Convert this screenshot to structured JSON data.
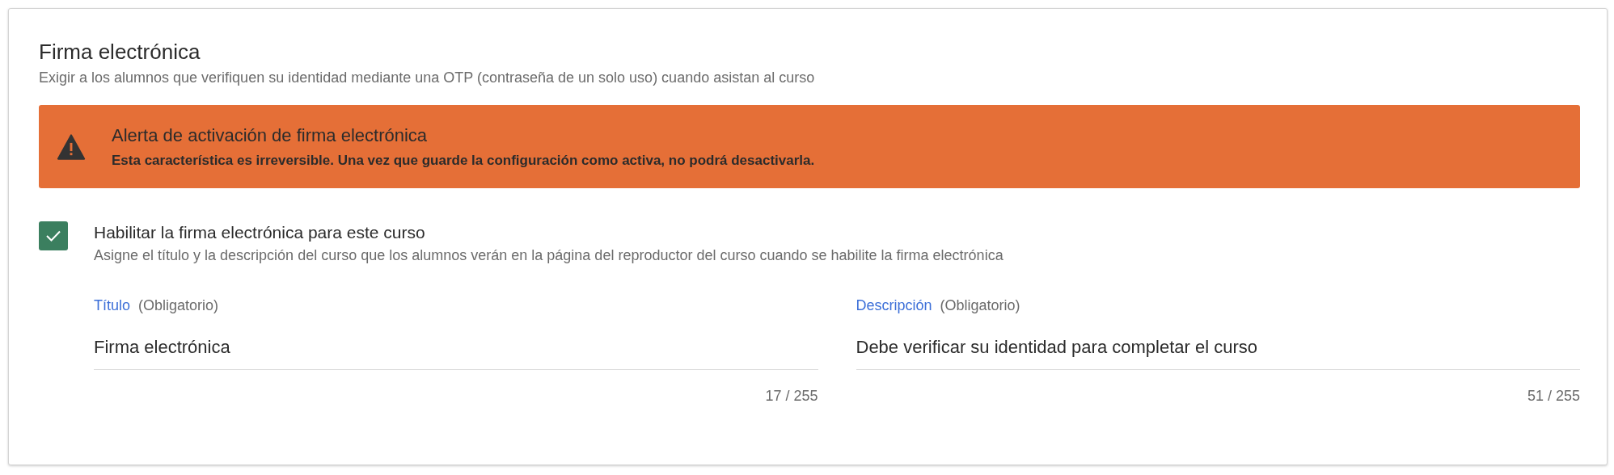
{
  "section": {
    "title": "Firma electrónica",
    "description": "Exigir a los alumnos que verifiquen su identidad mediante una OTP (contraseña de un solo uso) cuando asistan al curso"
  },
  "alert": {
    "title": "Alerta de activación de firma electrónica",
    "message": "Esta característica es irreversible. Una vez que guarde la configuración como activa, no podrá desactivarla."
  },
  "checkbox": {
    "label": "Habilitar la firma electrónica para este curso",
    "description": "Asigne el título y la descripción del curso que los alumnos verán en la página del reproductor del curso cuando se habilite la firma electrónica",
    "checked": true
  },
  "fields": [
    {
      "label": "Título",
      "hint": "(Obligatorio)",
      "value": "Firma electrónica",
      "counter": "17 / 255"
    },
    {
      "label": "Descripción",
      "hint": "(Obligatorio)",
      "value": "Debe verificar su identidad para completar el curso",
      "counter": "51 / 255"
    }
  ]
}
